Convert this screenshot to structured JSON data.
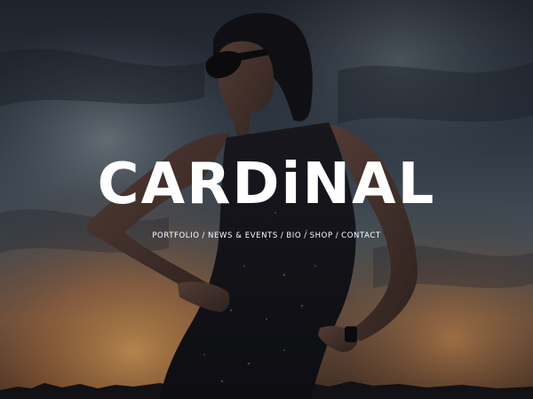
{
  "brand": {
    "logo_text": "CARDiNAL"
  },
  "nav": {
    "items": [
      {
        "label": "PORTFOLIO"
      },
      {
        "label": "NEWS & EVENTS"
      },
      {
        "label": "BIO"
      },
      {
        "label": "SHOP"
      },
      {
        "label": "CONTACT"
      }
    ],
    "separator": "/"
  },
  "colors": {
    "text": "#ffffff",
    "sky_dark": "#1e2530",
    "sunset": "#e08a40"
  }
}
